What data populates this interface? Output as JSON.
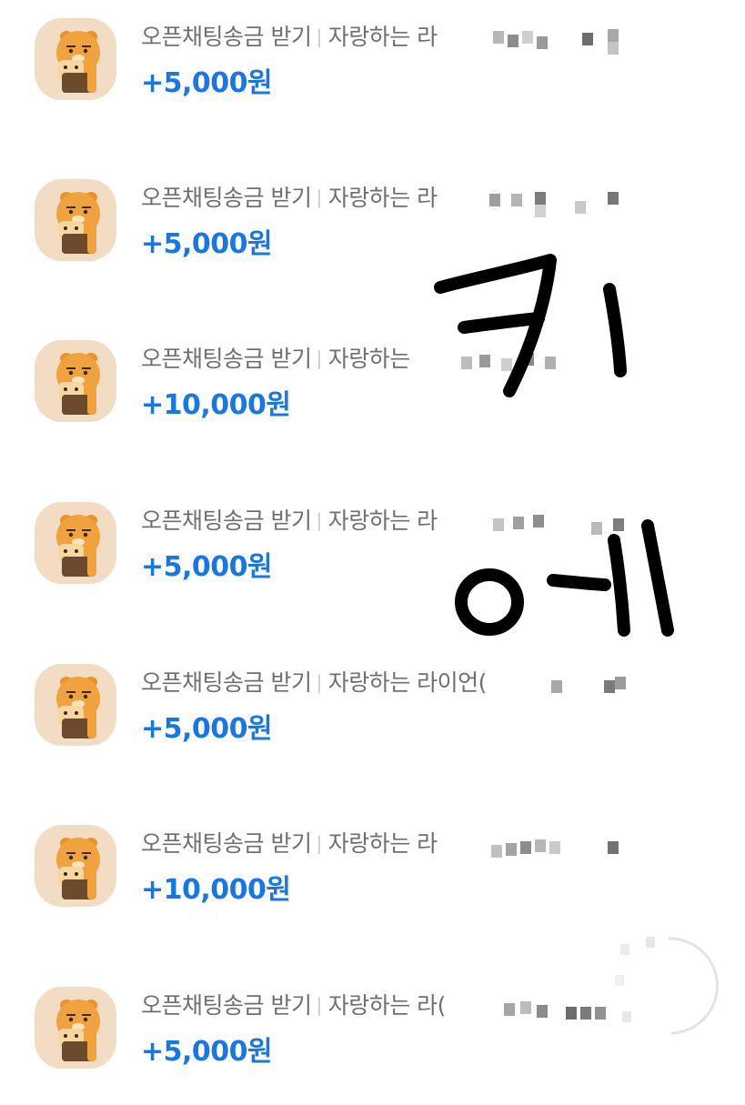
{
  "transactions": [
    {
      "title": "오픈채팅송금 받기",
      "detail": "자랑하는 라",
      "amount": "+5,000원"
    },
    {
      "title": "오픈채팅송금 받기",
      "detail": "자랑하는 라",
      "amount": "+5,000원"
    },
    {
      "title": "오픈채팅송금 받기",
      "detail": "자랑하는",
      "amount": "+10,000원"
    },
    {
      "title": "오픈채팅송금 받기",
      "detail": "자랑하는 라",
      "amount": "+5,000원"
    },
    {
      "title": "오픈채팅송금 받기",
      "detail": "자랑하는 라이언(",
      "amount": "+5,000원"
    },
    {
      "title": "오픈채팅송금 받기",
      "detail": "자랑하는 라",
      "amount": "+10,000원"
    },
    {
      "title": "오픈채팅송금 받기",
      "detail": "자랑하는 라(",
      "amount": "+5,000원"
    }
  ],
  "separator": "|",
  "handwritten_note": "키에",
  "colors": {
    "amount": "#1877e6",
    "title": "#6f6f6f",
    "icon_background": "#f2dcc4",
    "character": "#f0a23c",
    "ink": "#000000"
  },
  "icons": {
    "transaction_icon": "ryan-character-icon"
  }
}
